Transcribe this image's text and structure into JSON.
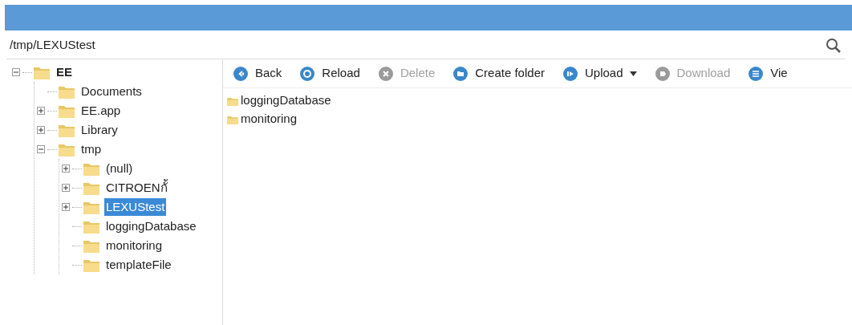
{
  "path_field": {
    "value": "/tmp/LEXUStest"
  },
  "tree": [
    {
      "label": "EE",
      "expanded": true,
      "selected": false,
      "bold": true,
      "children": [
        {
          "label": "Documents",
          "selected": false
        },
        {
          "label": "EE.app",
          "expanded": false,
          "selected": false
        },
        {
          "label": "Library",
          "expanded": false,
          "selected": false
        },
        {
          "label": "tmp",
          "expanded": true,
          "selected": false,
          "children": [
            {
              "label": "(null)",
              "expanded": false,
              "selected": false
            },
            {
              "label": "CITROENกั้",
              "expanded": false,
              "selected": false
            },
            {
              "label": "LEXUStest",
              "expanded": false,
              "selected": true
            },
            {
              "label": "loggingDatabase",
              "selected": false
            },
            {
              "label": "monitoring",
              "selected": false
            },
            {
              "label": "templateFile",
              "selected": false
            }
          ]
        }
      ]
    }
  ],
  "toolbar": [
    {
      "kind": "back",
      "label": "Back",
      "disabled": false
    },
    {
      "kind": "reload",
      "label": "Reload",
      "disabled": false
    },
    {
      "kind": "delete",
      "label": "Delete",
      "disabled": true
    },
    {
      "kind": "create-folder",
      "label": "Create folder",
      "disabled": false
    },
    {
      "kind": "upload",
      "label": "Upload",
      "disabled": false,
      "dropdown": true
    },
    {
      "kind": "download",
      "label": "Download",
      "disabled": true
    },
    {
      "kind": "view",
      "label": "Vie",
      "disabled": false
    }
  ],
  "files": [
    {
      "name": "loggingDatabase"
    },
    {
      "name": "monitoring"
    }
  ]
}
